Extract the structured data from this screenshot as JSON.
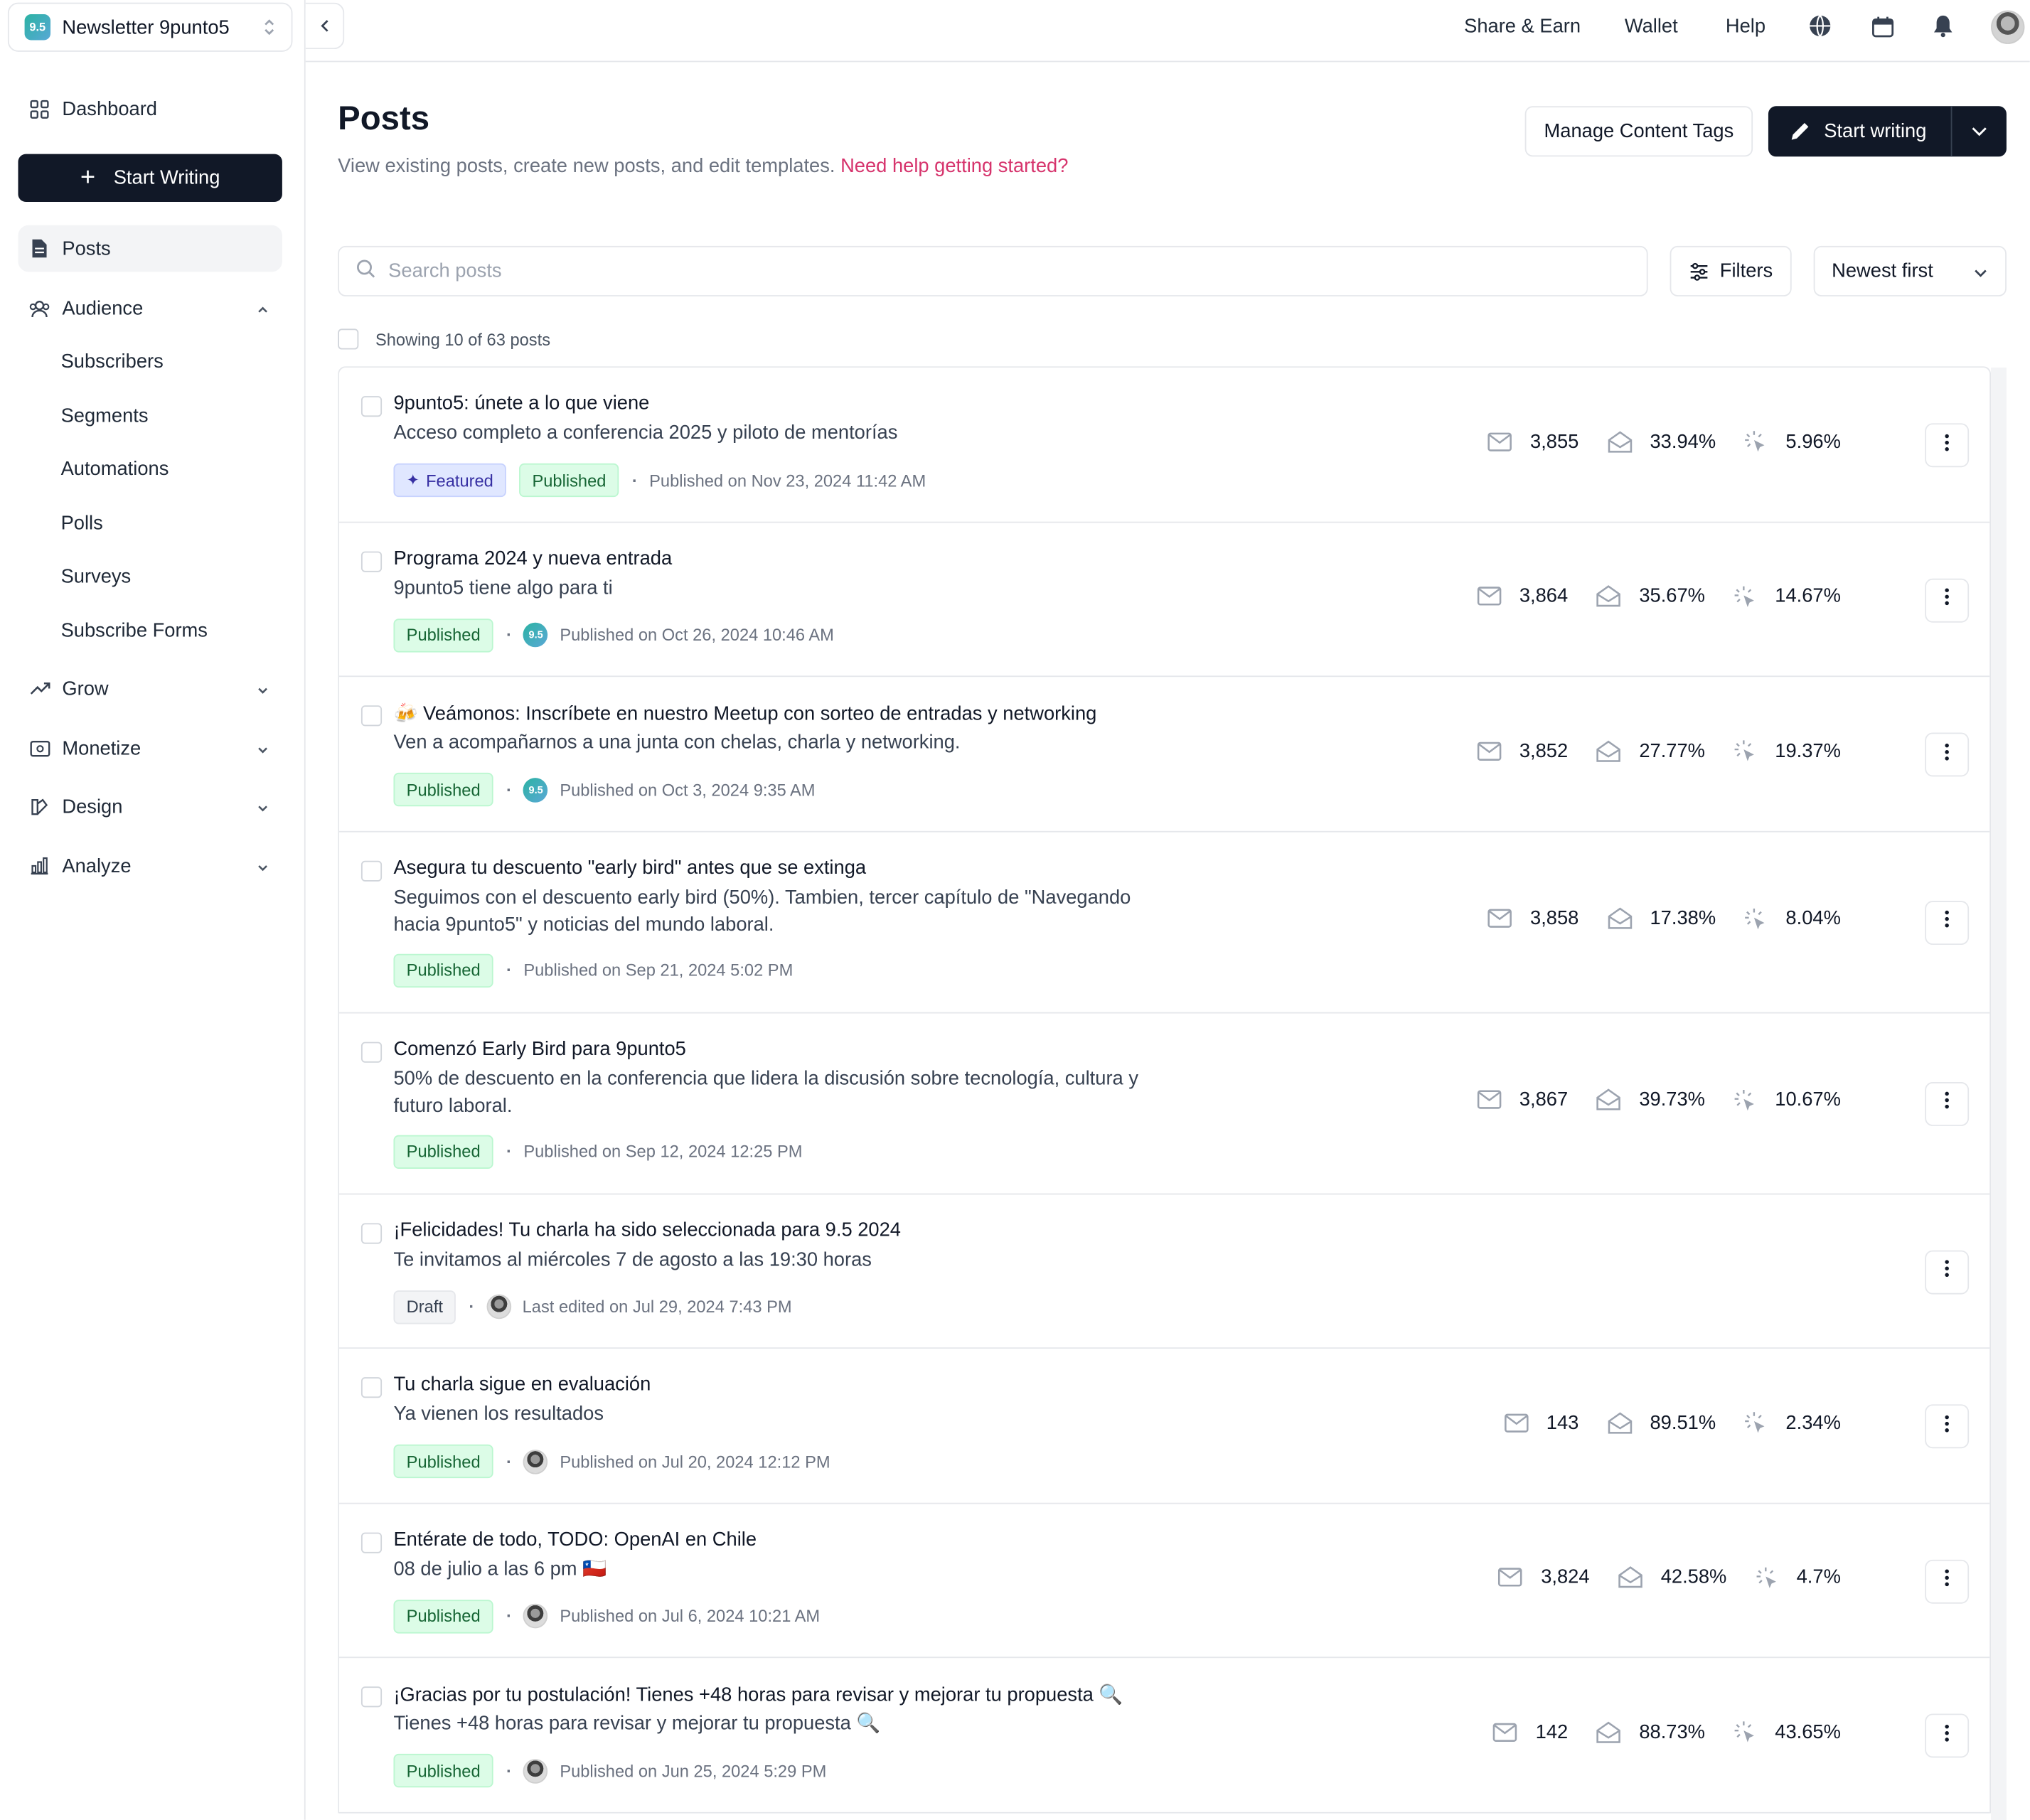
{
  "workspace": {
    "name": "Newsletter 9punto5",
    "logo_text": "9.5"
  },
  "sidebar": {
    "dashboard": "Dashboard",
    "start_writing": "Start Writing",
    "posts": "Posts",
    "audience": "Audience",
    "audience_items": [
      "Subscribers",
      "Segments",
      "Automations",
      "Polls",
      "Surveys",
      "Subscribe Forms"
    ],
    "grow": "Grow",
    "monetize": "Monetize",
    "design": "Design",
    "analyze": "Analyze"
  },
  "topbar": {
    "share_earn": "Share & Earn",
    "wallet": "Wallet",
    "help": "Help"
  },
  "header": {
    "title": "Posts",
    "subtitle": "View existing posts, create new posts, and edit templates.",
    "help_link": "Need help getting started?",
    "manage_tags": "Manage Content Tags",
    "start_writing": "Start writing"
  },
  "toolbar": {
    "search_placeholder": "Search posts",
    "filters": "Filters",
    "sort": "Newest first",
    "showing": "Showing 10 of 63 posts"
  },
  "posts": [
    {
      "title": "9punto5: únete a lo que viene",
      "subtitle": "Acceso completo a conferencia 2025 y piloto de mentorías",
      "featured": "Featured",
      "status": "Published",
      "author": "none",
      "date": "Published on Nov 23, 2024 11:42 AM",
      "recipients": "3,855",
      "open_rate": "33.94%",
      "click_rate": "5.96%"
    },
    {
      "title": "Programa 2024 y nueva entrada",
      "subtitle": "9punto5 tiene algo para ti",
      "status": "Published",
      "author": "logo",
      "date": "Published on Oct 26, 2024 10:46 AM",
      "recipients": "3,864",
      "open_rate": "35.67%",
      "click_rate": "14.67%"
    },
    {
      "title": "🍻 Veámonos: Inscríbete en nuestro Meetup con sorteo de entradas y networking",
      "subtitle": "Ven a acompañarnos a una junta con chelas, charla y networking.",
      "status": "Published",
      "author": "logo",
      "date": "Published on Oct 3, 2024 9:35 AM",
      "recipients": "3,852",
      "open_rate": "27.77%",
      "click_rate": "19.37%"
    },
    {
      "title": "Asegura tu descuento \"early bird\" antes que se extinga",
      "subtitle": "Seguimos con el descuento early bird (50%). Tambien, tercer capítulo de \"Navegando hacia 9punto5\" y noticias del mundo laboral.",
      "status": "Published",
      "author": "none",
      "date": "Published on Sep 21, 2024 5:02 PM",
      "recipients": "3,858",
      "open_rate": "17.38%",
      "click_rate": "8.04%"
    },
    {
      "title": "Comenzó Early Bird para 9punto5",
      "subtitle": "50% de descuento en la conferencia que lidera la discusión sobre tecnología, cultura y futuro laboral.",
      "status": "Published",
      "author": "none",
      "date": "Published on Sep 12, 2024 12:25 PM",
      "recipients": "3,867",
      "open_rate": "39.73%",
      "click_rate": "10.67%"
    },
    {
      "title": "¡Felicidades! Tu charla ha sido seleccionada para 9.5 2024",
      "subtitle": "Te invitamos al miércoles 7 de agosto a las 19:30 horas",
      "status": "Draft",
      "author": "person",
      "date": "Last edited on Jul 29, 2024 7:43 PM",
      "recipients": "",
      "open_rate": "",
      "click_rate": ""
    },
    {
      "title": "Tu charla sigue en evaluación",
      "subtitle": "Ya vienen los resultados",
      "status": "Published",
      "author": "person",
      "date": "Published on Jul 20, 2024 12:12 PM",
      "recipients": "143",
      "open_rate": "89.51%",
      "click_rate": "2.34%"
    },
    {
      "title": "Entérate de todo, TODO: OpenAI en Chile",
      "subtitle": "08 de julio a las 6 pm 🇨🇱",
      "status": "Published",
      "author": "person",
      "date": "Published on Jul 6, 2024 10:21 AM",
      "recipients": "3,824",
      "open_rate": "42.58%",
      "click_rate": "4.7%"
    },
    {
      "title": "¡Gracias por tu postulación! Tienes +48 horas para revisar y mejorar tu propuesta 🔍",
      "subtitle": "Tienes +48 horas para revisar y mejorar tu propuesta 🔍",
      "status": "Published",
      "author": "person",
      "date": "Published on Jun 25, 2024 5:29 PM",
      "recipients": "142",
      "open_rate": "88.73%",
      "click_rate": "43.65%"
    }
  ],
  "colors": {
    "accent_link": "#d6336c",
    "primary_button": "#111827",
    "published_bg": "#dcfce7",
    "featured_bg": "#e0e7ff"
  }
}
